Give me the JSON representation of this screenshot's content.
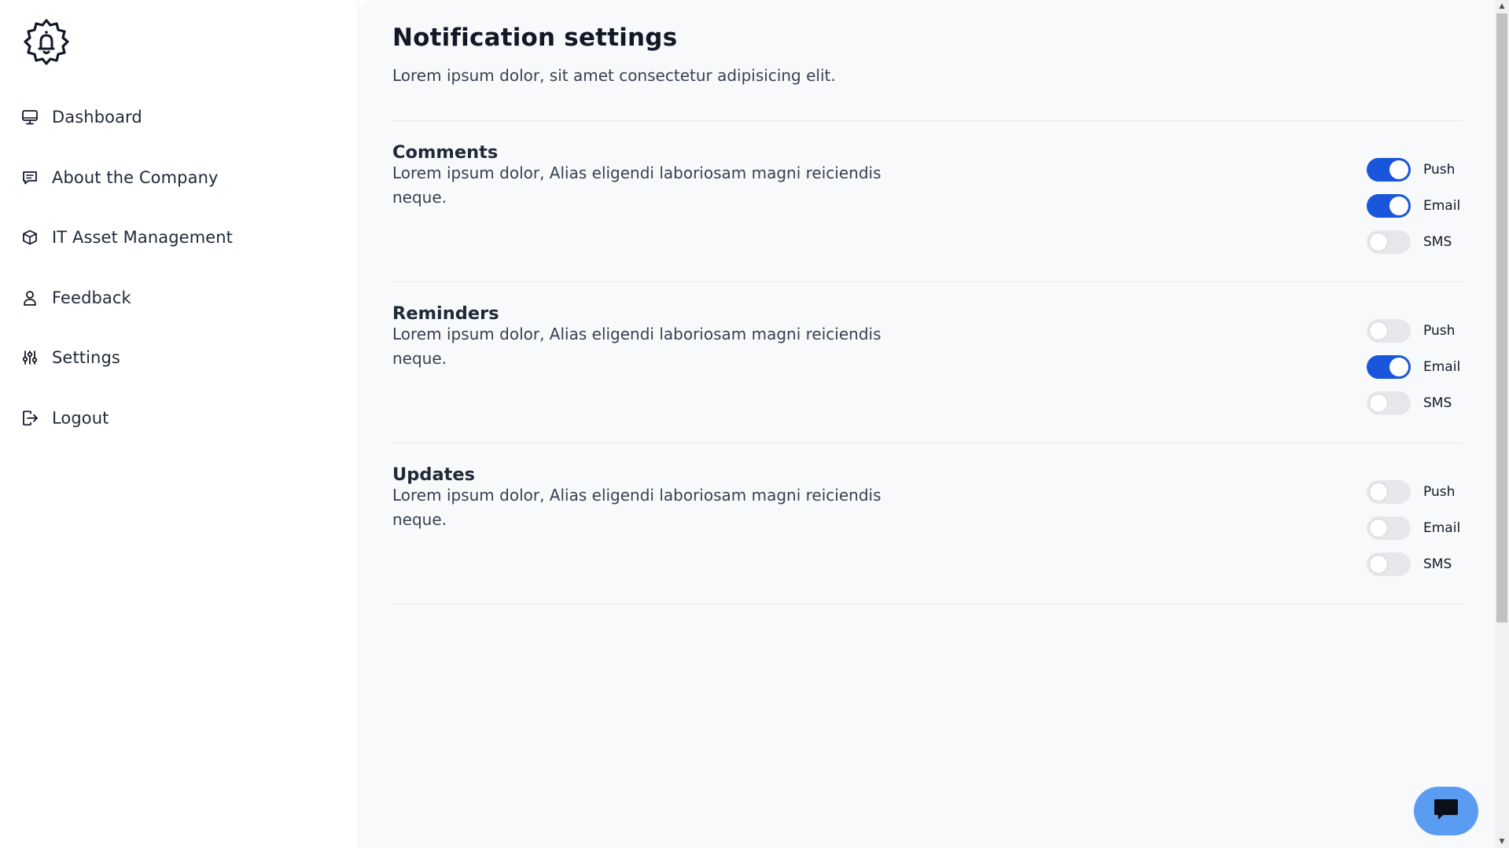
{
  "sidebar": {
    "logo_icon": "gear-bell-icon",
    "items": [
      {
        "label": "Dashboard",
        "icon": "monitor-icon"
      },
      {
        "label": "About the Company",
        "icon": "message-icon"
      },
      {
        "label": "IT Asset Management",
        "icon": "cube-icon"
      },
      {
        "label": "Feedback",
        "icon": "user-icon"
      },
      {
        "label": "Settings",
        "icon": "sliders-icon"
      },
      {
        "label": "Logout",
        "icon": "logout-icon"
      }
    ]
  },
  "main": {
    "title": "Notification settings",
    "subtitle": "Lorem ipsum dolor, sit amet consectetur adipisicing elit.",
    "sections": [
      {
        "title": "Comments",
        "description": "Lorem ipsum dolor, Alias eligendi laboriosam magni reiciendis neque.",
        "toggles": [
          {
            "label": "Push",
            "on": true
          },
          {
            "label": "Email",
            "on": true
          },
          {
            "label": "SMS",
            "on": false
          }
        ]
      },
      {
        "title": "Reminders",
        "description": "Lorem ipsum dolor, Alias eligendi laboriosam magni reiciendis neque.",
        "toggles": [
          {
            "label": "Push",
            "on": false
          },
          {
            "label": "Email",
            "on": true
          },
          {
            "label": "SMS",
            "on": false
          }
        ]
      },
      {
        "title": "Updates",
        "description": "Lorem ipsum dolor, Alias eligendi laboriosam magni reiciendis neque.",
        "toggles": [
          {
            "label": "Push",
            "on": false
          },
          {
            "label": "Email",
            "on": false
          },
          {
            "label": "SMS",
            "on": false
          }
        ]
      }
    ]
  },
  "chat": {
    "icon": "chat-bubble-icon"
  },
  "colors": {
    "accent": "#1a56db",
    "chat_button": "#5b9cf3",
    "main_background": "#f8f9fb"
  }
}
